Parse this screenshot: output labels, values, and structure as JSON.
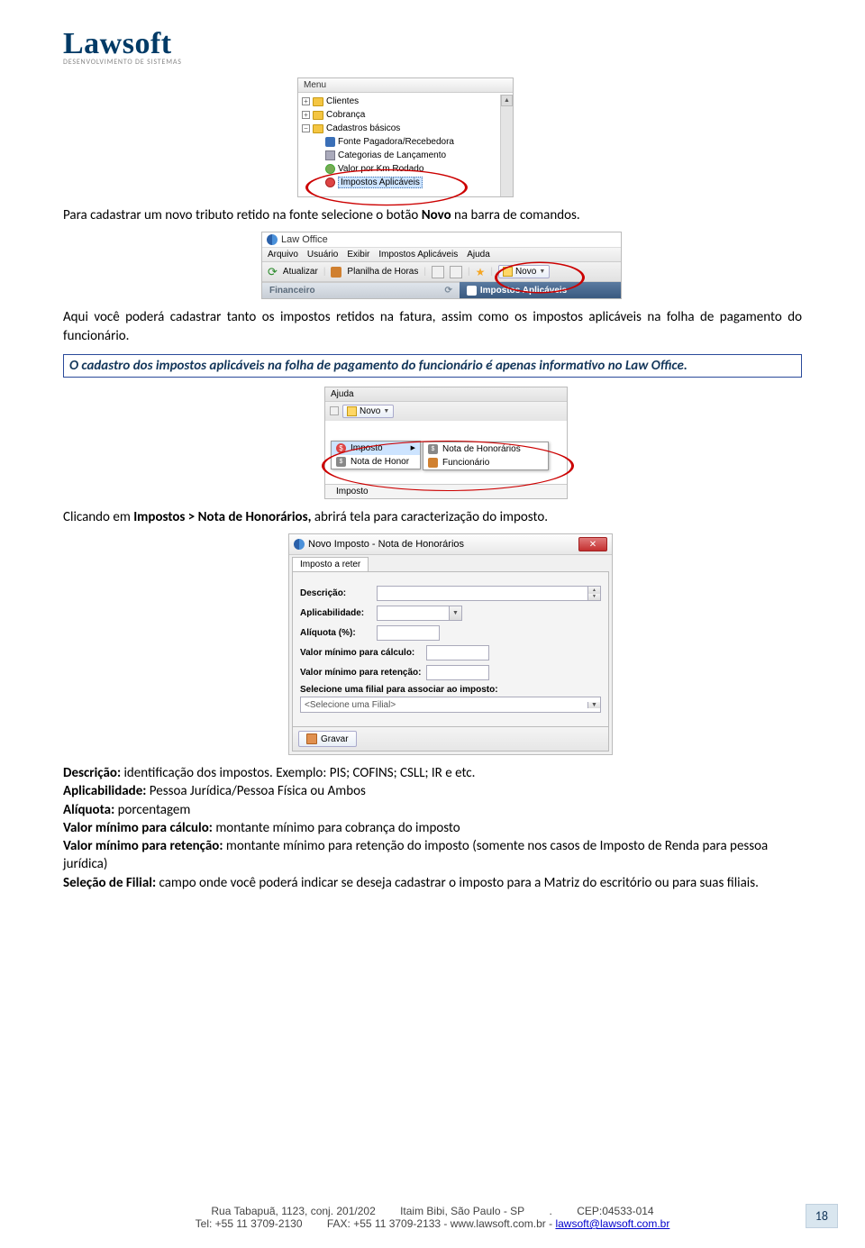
{
  "logo": {
    "main": "Lawsoft",
    "sub": "DESENVOLVIMENTO DE SISTEMAS"
  },
  "ss1": {
    "title": "Menu",
    "items": {
      "clientes": "Clientes",
      "cobranca": "Cobrança",
      "cadastros": "Cadastros básicos",
      "fonte": "Fonte Pagadora/Recebedora",
      "categorias": "Categorias de Lançamento",
      "valorkm": "Valor por Km Rodado",
      "impostos": "Impostos Aplicáveis"
    }
  },
  "p1": {
    "pre": "Para cadastrar um novo tributo retido na fonte selecione o botão ",
    "bold": "Novo",
    "post": " na barra de comandos."
  },
  "ss2": {
    "title": "Law Office",
    "menu": {
      "arquivo": "Arquivo",
      "usuario": "Usuário",
      "exibir": "Exibir",
      "impostos": "Impostos Aplicáveis",
      "ajuda": "Ajuda"
    },
    "toolbar": {
      "atualizar": "Atualizar",
      "planilha": "Planilha de Horas",
      "novo": "Novo"
    },
    "strip": {
      "left": "Financeiro",
      "right": "Impostos Aplicáveis"
    }
  },
  "p2": "Aqui você poderá cadastrar tanto os impostos retidos na fatura, assim como os impostos aplicáveis na folha de pagamento do funcionário.",
  "infoBox": "O cadastro dos impostos aplicáveis na folha de pagamento do funcionário é apenas informativo no Law Office.",
  "ss3": {
    "top": "Ajuda",
    "novo": "Novo",
    "menu": {
      "imposto": "Imposto",
      "nota_hon_row": "Nota de Honor",
      "imposto_bottom": "Imposto"
    },
    "submenu": {
      "nota": "Nota de Honorários",
      "func": "Funcionário"
    }
  },
  "p3": {
    "pre": "Clicando em ",
    "bold": "Impostos > Nota de Honorários,",
    "post": " abrirá tela para caracterização do imposto."
  },
  "ss4": {
    "title": "Novo Imposto - Nota de Honorários",
    "tab": "Imposto a reter",
    "labels": {
      "descricao": "Descrição:",
      "aplicabilidade": "Aplicabilidade:",
      "aliquota": "Alíquota (%):",
      "valmin_calc": "Valor mínimo para cálculo:",
      "valmin_ret": "Valor mínimo para retenção:",
      "filial_title": "Selecione uma filial para associar ao imposto:",
      "filial_placeholder": "<Selecione uma Filial>"
    },
    "gravar": "Gravar"
  },
  "defs": {
    "l1_b": "Descrição:",
    "l1_t": " identificação dos impostos. Exemplo: PIS; COFINS; CSLL; IR e etc.",
    "l2_b": "Aplicabilidade:",
    "l2_t": " Pessoa Jurídica/Pessoa Física ou Ambos",
    "l3_b": "Alíquota:",
    "l3_t": " porcentagem",
    "l4_b": "Valor mínimo para cálculo:",
    "l4_t": " montante mínimo para cobrança do imposto",
    "l5_b": "Valor mínimo para retenção:",
    "l5_t": " montante mínimo para retenção do imposto (somente nos casos de Imposto de Renda para pessoa jurídica)",
    "l6_b": "Seleção de Filial:",
    "l6_t": " campo onde você poderá indicar se deseja cadastrar o imposto para a Matriz do escritório ou para suas filiais."
  },
  "footer": {
    "line1_a": "Rua Tabapuã, 1123, conj. 201/202",
    "line1_b": "Itaim Bibi, São Paulo - SP",
    "line1_c": ".",
    "line1_d": "CEP:04533-014",
    "line2_a": "Tel: +55 11 3709-2130",
    "line2_b": "FAX: +55 11 3709-2133 - www.lawsoft.com.br - ",
    "line2_link": "lawsoft@lawsoft.com.br"
  },
  "pageNum": "18"
}
